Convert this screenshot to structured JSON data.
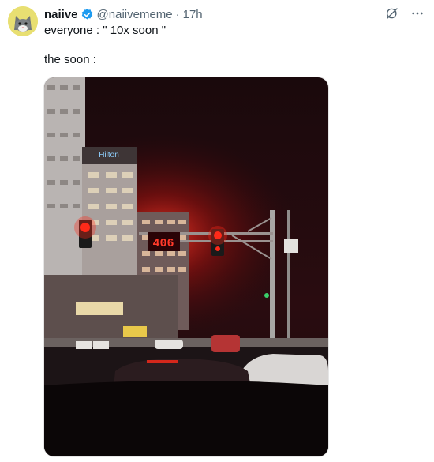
{
  "tweet": {
    "author_name": "naiive",
    "handle": "@naiivememe",
    "separator": "·",
    "time": "17h",
    "lines": [
      "everyone : \" 10x soon \"",
      "the soon :"
    ]
  },
  "photo": {
    "sign_text": "Hilton",
    "countdown": "406"
  },
  "colors": {
    "verified": "#1d9bf0",
    "signal_red": "#ff2a1a",
    "muted": "#536471"
  },
  "icons": {
    "avatar": "cat-avatar",
    "verified": "verified-badge-icon",
    "grok": "grok-icon",
    "more": "more-icon"
  }
}
